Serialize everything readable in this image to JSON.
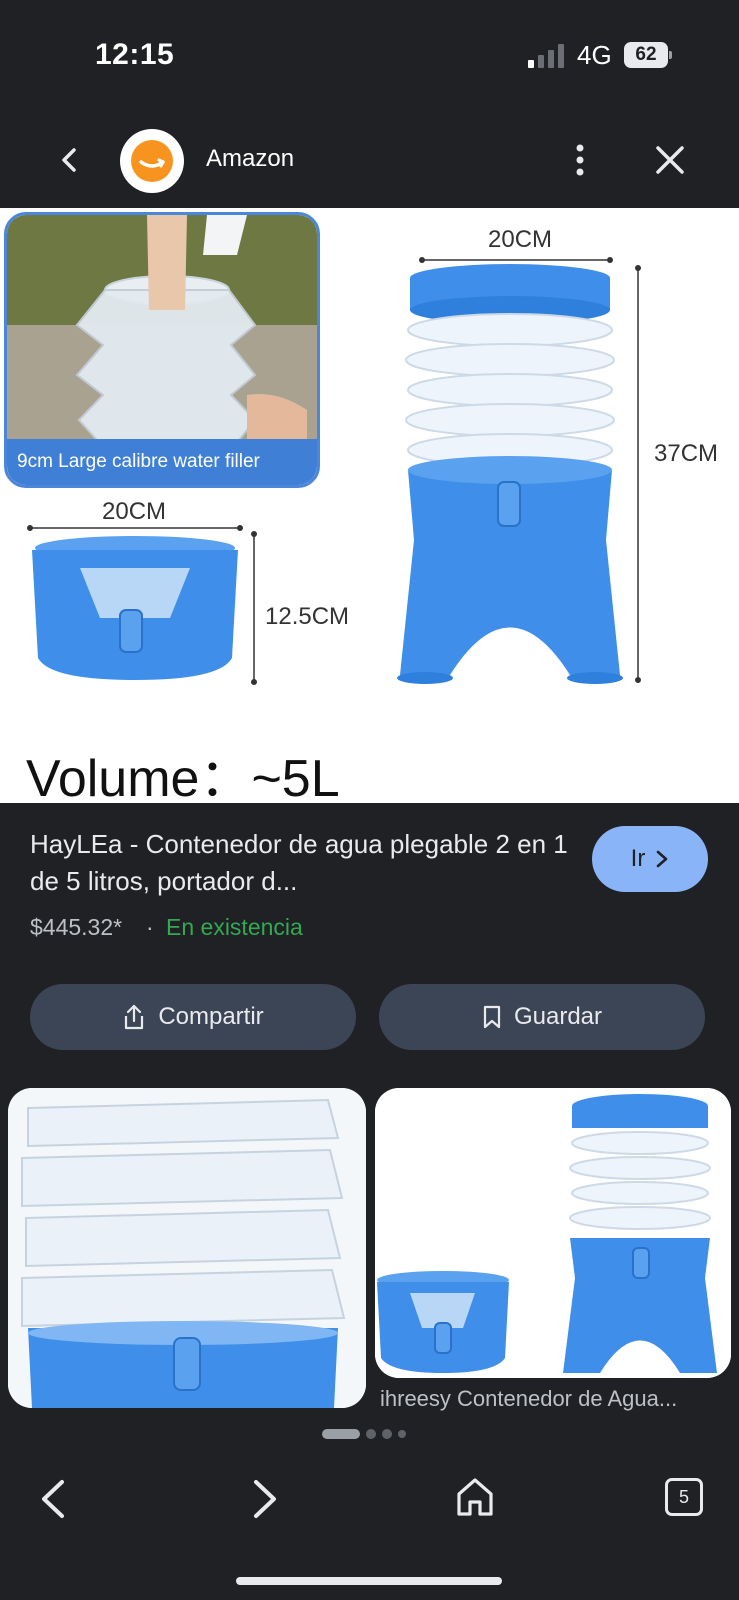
{
  "status_bar": {
    "time": "12:15",
    "network": "4G",
    "battery": "62"
  },
  "header": {
    "site_name": "Amazon",
    "logo_icon": "amazon-smile-icon"
  },
  "hero": {
    "photo_caption": "9cm Large calibre water filler",
    "dim_width_top": "20CM",
    "dim_height": "37CM",
    "dim_width_small": "20CM",
    "dim_height_small": "12.5CM",
    "volume_text": "Volume：~5L"
  },
  "product": {
    "title": "HayLEa - Contenedor de agua plegable 2 en 1 de 5 litros, portador d...",
    "price": "$445.32*",
    "separator": "·",
    "availability": "En existencia",
    "go_label": "Ir",
    "share_label": "Compartir",
    "save_label": "Guardar"
  },
  "related": {
    "card2_caption": "ihreesy Contenedor de Agua..."
  },
  "pager": {
    "active_index": 0,
    "count": 4
  },
  "bottom_nav": {
    "tab_count": "5"
  },
  "colors": {
    "accent": "#8ab4f8",
    "stock": "#34a853",
    "product_blue": "#3f8fea",
    "pill_bg": "#3c4556"
  }
}
